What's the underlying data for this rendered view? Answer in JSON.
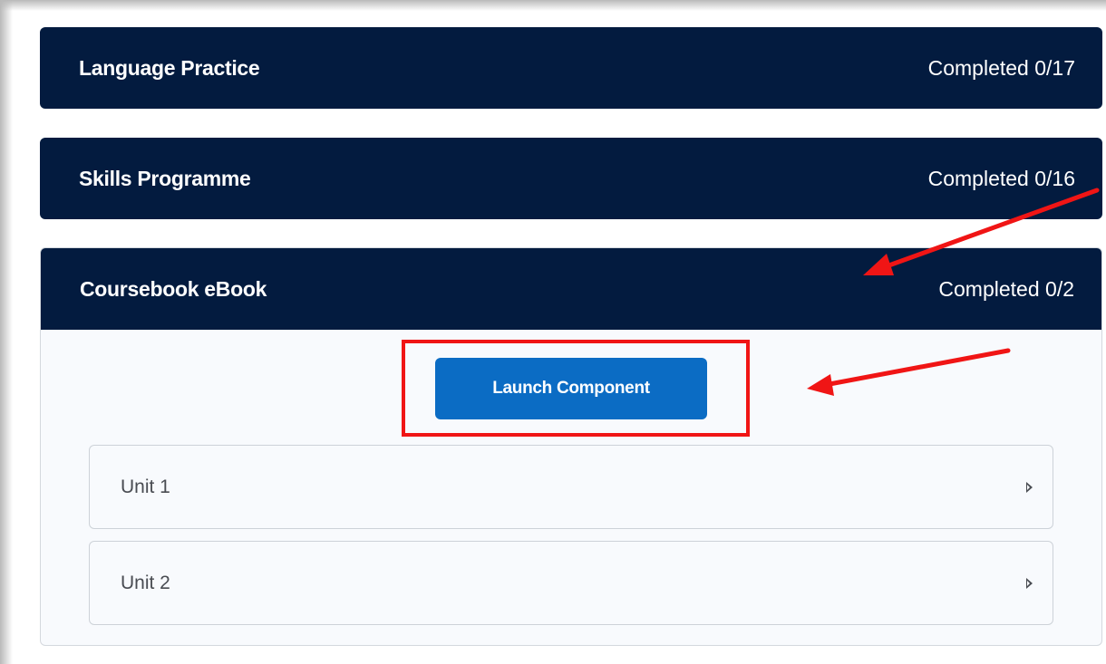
{
  "sections": [
    {
      "title": "Language Practice",
      "status": "Completed 0/17"
    },
    {
      "title": "Skills Programme",
      "status": "Completed 0/16"
    },
    {
      "title": "Coursebook eBook",
      "status": "Completed 0/2"
    }
  ],
  "expanded": {
    "launch_label": "Launch Component",
    "units": [
      {
        "label": "Unit 1",
        "icon": "caret-right-icon"
      },
      {
        "label": "Unit 2",
        "icon": "caret-right-icon"
      }
    ]
  },
  "colors": {
    "header_bg": "#031b3f",
    "button_bg": "#0b6cc4",
    "annotation": "#f01515",
    "panel_bg": "#f8fafd"
  }
}
